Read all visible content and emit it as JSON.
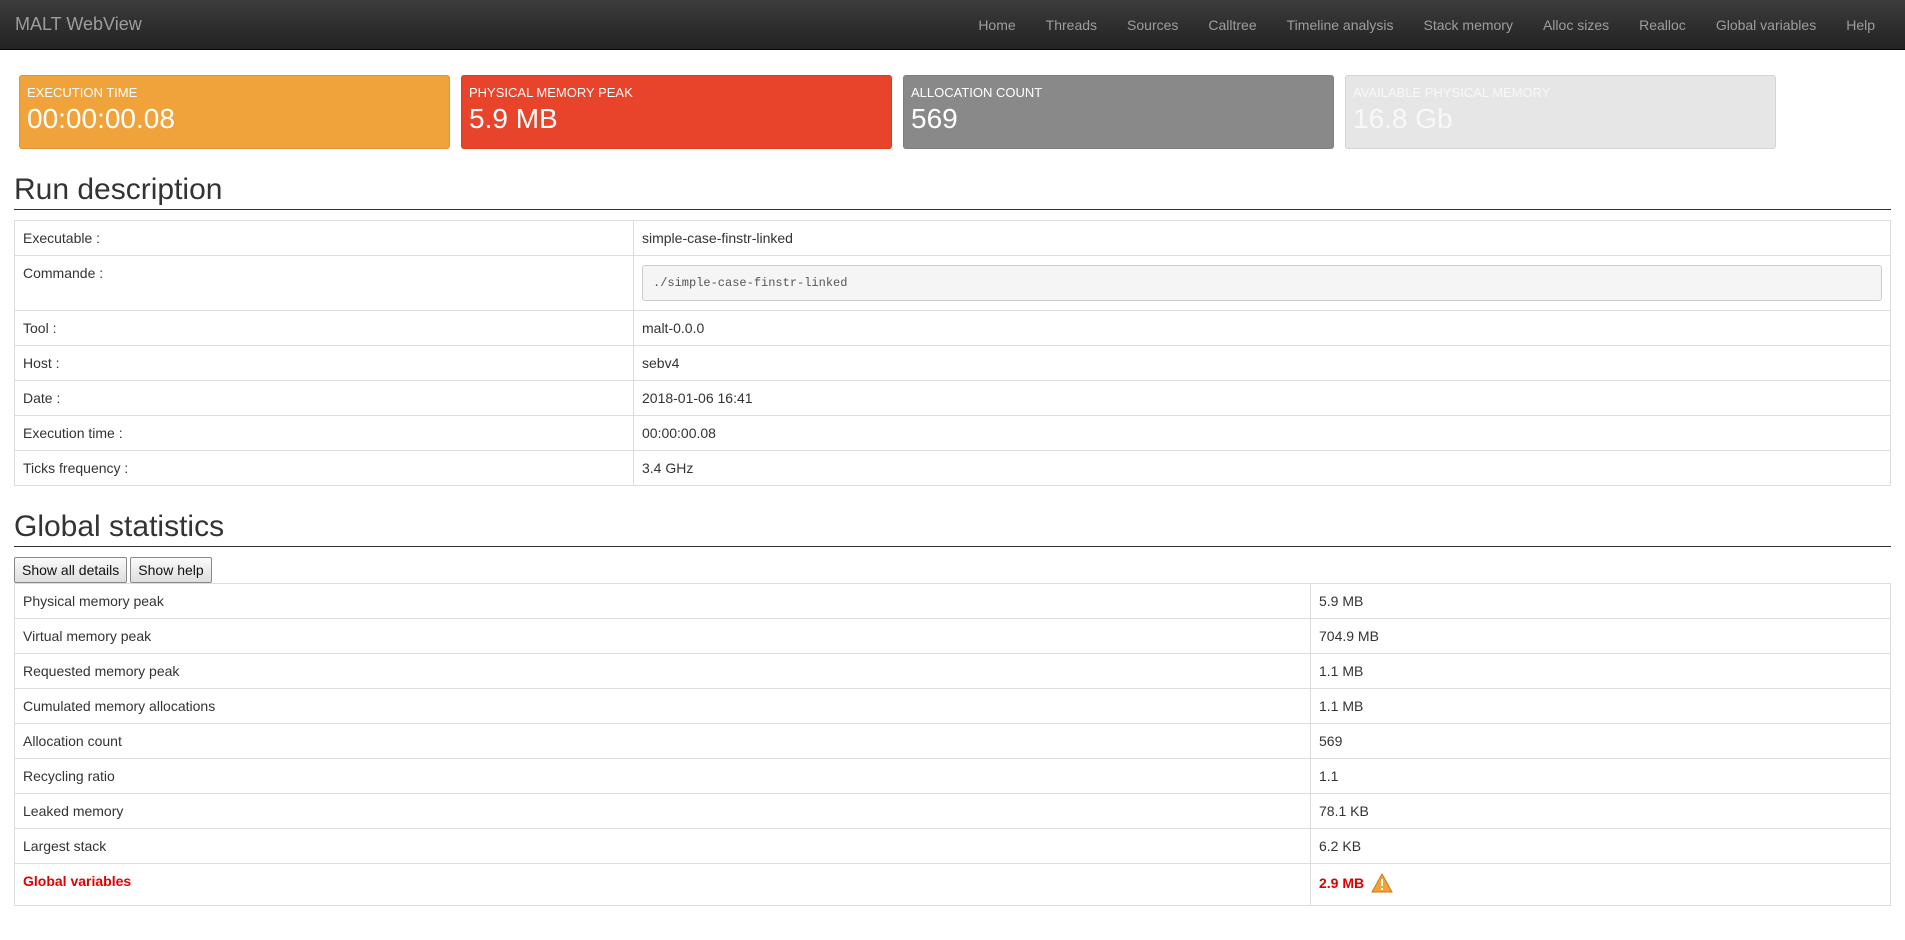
{
  "app": {
    "brand": "MALT WebView",
    "nav": [
      "Home",
      "Threads",
      "Sources",
      "Calltree",
      "Timeline analysis",
      "Stack memory",
      "Alloc sizes",
      "Realloc",
      "Global variables",
      "Help"
    ]
  },
  "stats": [
    {
      "label": "EXECUTION TIME",
      "value": "00:00:00.08",
      "color": "#f0a33a"
    },
    {
      "label": "PHYSICAL MEMORY PEAK",
      "value": "5.9 MB",
      "color": "#e8432b"
    },
    {
      "label": "ALLOCATION COUNT",
      "value": "569",
      "color": "#898989"
    },
    {
      "label": "AVAILABLE PHYSICAL MEMORY",
      "value": "16.8 Gb",
      "color": "#e6e6e6"
    }
  ],
  "run": {
    "title": "Run description",
    "executable": {
      "label": "Executable :",
      "value": "simple-case-finstr-linked"
    },
    "command": {
      "label": "Commande :",
      "value": "./simple-case-finstr-linked"
    },
    "tool": {
      "label": "Tool :",
      "value": "malt-0.0.0"
    },
    "host": {
      "label": "Host :",
      "value": "sebv4"
    },
    "date": {
      "label": "Date :",
      "value": "2018-01-06 16:41"
    },
    "exec_time": {
      "label": "Execution time :",
      "value": "00:00:00.08"
    },
    "ticks": {
      "label": "Ticks frequency :",
      "value": "3.4 GHz"
    }
  },
  "global": {
    "title": "Global statistics",
    "show_details": "Show all details",
    "show_help": "Show help",
    "rows": [
      {
        "label": "Physical memory peak",
        "value": "5.9 MB"
      },
      {
        "label": "Virtual memory peak",
        "value": "704.9 MB"
      },
      {
        "label": "Requested memory peak",
        "value": "1.1 MB"
      },
      {
        "label": "Cumulated memory allocations",
        "value": "1.1 MB"
      },
      {
        "label": "Allocation count",
        "value": "569"
      },
      {
        "label": "Recycling ratio",
        "value": "1.1"
      },
      {
        "label": "Leaked memory",
        "value": "78.1 KB"
      },
      {
        "label": "Largest stack",
        "value": "6.2 KB"
      },
      {
        "label": "Global variables",
        "value": "2.9 MB",
        "alert": true,
        "icon": "warning-icon"
      }
    ]
  }
}
